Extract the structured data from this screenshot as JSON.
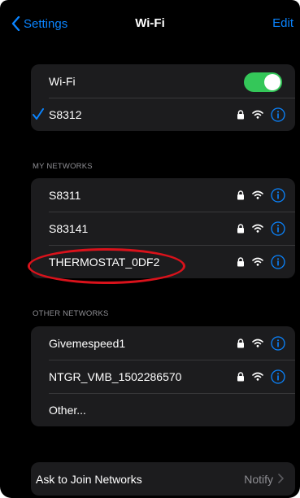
{
  "nav": {
    "back_label": "Settings",
    "title": "Wi-Fi",
    "edit_label": "Edit"
  },
  "wifi_group": {
    "toggle_label": "Wi-Fi",
    "toggle_on": true,
    "connected_network": "S8312"
  },
  "my_networks": {
    "header": "MY NETWORKS",
    "items": [
      {
        "name": "S8311"
      },
      {
        "name": "S83141"
      },
      {
        "name": "THERMOSTAT_0DF2"
      }
    ]
  },
  "other_networks": {
    "header": "OTHER NETWORKS",
    "items": [
      {
        "name": "Givemespeed1"
      },
      {
        "name": "NTGR_VMB_1502286570"
      },
      {
        "name": "Other..."
      }
    ]
  },
  "ask_to_join": {
    "label": "Ask to Join Networks",
    "value": "Notify"
  },
  "colors": {
    "accent": "#0a84ff",
    "toggle_on": "#34c759",
    "annotation": "#d9121b",
    "cell_bg": "#1c1c1e",
    "background": "#000000"
  },
  "icons": [
    "chevron-left-icon",
    "checkmark-icon",
    "lock-icon",
    "wifi-icon",
    "info-icon",
    "chevron-right-icon"
  ]
}
